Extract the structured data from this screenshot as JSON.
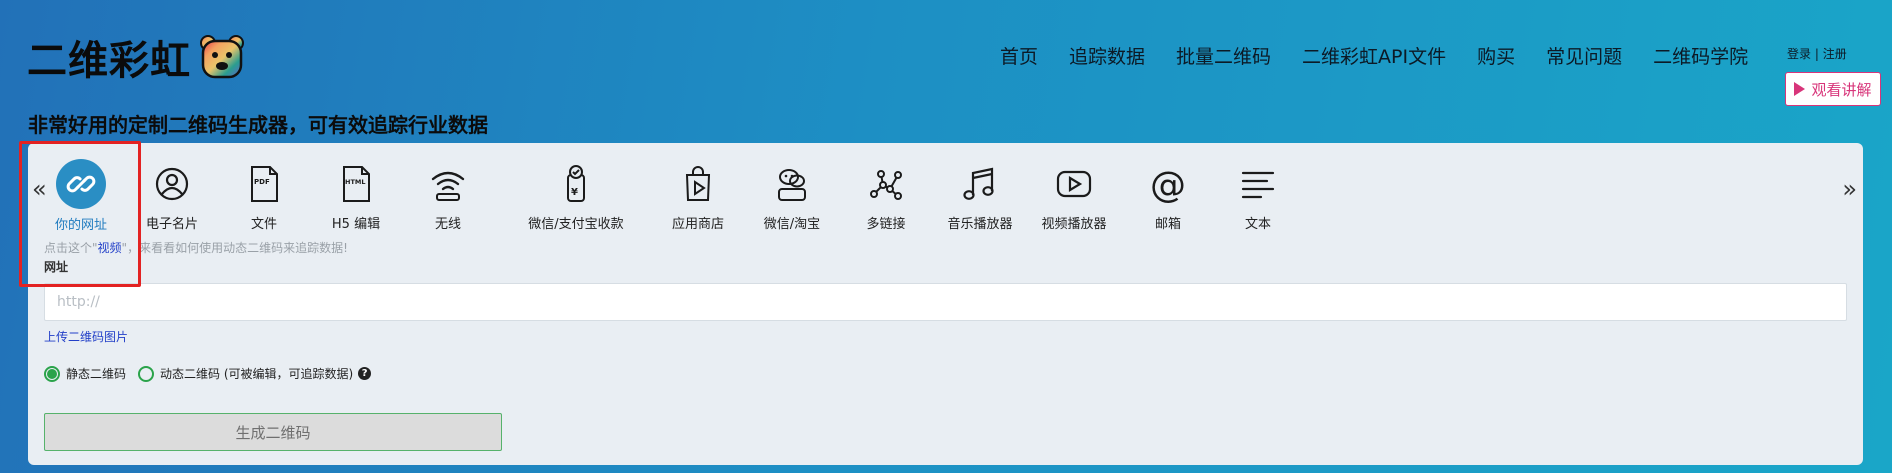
{
  "brand": {
    "name": "二维彩虹"
  },
  "nav": [
    "首页",
    "追踪数据",
    "批量二维码",
    "二维彩虹API文件",
    "购买",
    "常见问题",
    "二维码学院"
  ],
  "auth": {
    "login": "登录",
    "sep": " | ",
    "register": "注册"
  },
  "watch_button": "观看讲解",
  "tagline": "非常好用的定制二维码生成器，可有效追踪行业数据",
  "types": [
    {
      "label": "你的网址",
      "icon": "link-icon"
    },
    {
      "label": "电子名片",
      "icon": "contact-card-icon"
    },
    {
      "label": "文件",
      "icon": "pdf-file-icon"
    },
    {
      "label": "H5 编辑",
      "icon": "html-file-icon"
    },
    {
      "label": "无线",
      "icon": "wifi-icon"
    },
    {
      "label": "微信/支付宝收款",
      "icon": "payment-icon"
    },
    {
      "label": "应用商店",
      "icon": "app-store-icon"
    },
    {
      "label": "微信/淘宝",
      "icon": "wechat-taobao-icon"
    },
    {
      "label": "多链接",
      "icon": "multi-link-icon"
    },
    {
      "label": "音乐播放器",
      "icon": "music-icon"
    },
    {
      "label": "视频播放器",
      "icon": "video-player-icon"
    },
    {
      "label": "邮箱",
      "icon": "email-icon"
    },
    {
      "label": "文本",
      "icon": "text-icon"
    }
  ],
  "hint": {
    "before": "点击这个\"",
    "link": "视频",
    "after": "\"，来看看如何使用动态二维码来追踪数据!"
  },
  "url_field": {
    "label": "网址",
    "placeholder": "http://",
    "value": ""
  },
  "upload_link": "上传二维码图片",
  "qr_mode": {
    "static": "静态二维码",
    "dynamic": "动态二维码 (可被编辑，可追踪数据)",
    "selected": "static"
  },
  "generate_button": "生成二维码",
  "colors": {
    "accent": "#2a8ec4",
    "brand_pink": "#d8357a",
    "green": "#2aa34a",
    "highlight_red": "#e32222"
  }
}
